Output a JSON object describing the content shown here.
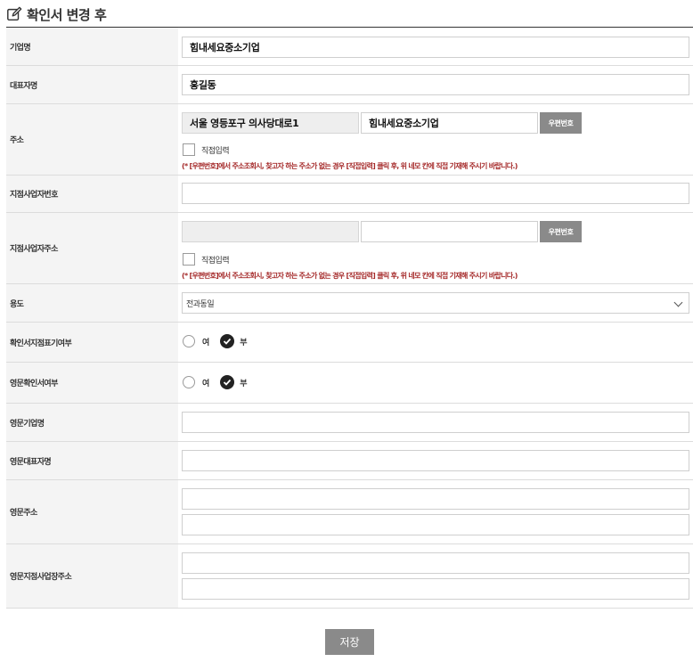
{
  "header": {
    "title": "확인서 변경 후",
    "icon": "edit-icon"
  },
  "fields": {
    "company_name": {
      "label": "기업명",
      "value": "힘내세요중소기업"
    },
    "ceo_name": {
      "label": "대표자명",
      "value": "홍길동"
    },
    "address": {
      "label": "주소",
      "street": "서울 영등포구 의사당대로1",
      "detail": "힘내세요중소기업",
      "zip_button": "우편번호",
      "manual_label": "직접입력",
      "notice": "(* [우편번호]에서 주소조회시, 찾고자 하는 주소가 없는 경우 [직접입력] 클릭 후, 위 네모 칸에 직접 기재해 주시기 바랍니다.)"
    },
    "branch_reg_no": {
      "label": "지점사업자번호",
      "value": ""
    },
    "branch_address": {
      "label": "지점사업자주소",
      "street": "",
      "detail": "",
      "zip_button": "우편번호",
      "manual_label": "직접입력",
      "notice": "(* [우편번호]에서 주소조회시, 찾고자 하는 주소가 없는 경우 [직접입력] 클릭 후, 위 네모 칸에 직접 기재해 주시기 바랍니다.)"
    },
    "purpose": {
      "label": "용도",
      "selected": "전과동일"
    },
    "branch_display": {
      "label": "확인서지점표기여부",
      "option_yes": "여",
      "option_no": "부",
      "selected": "부"
    },
    "english_cert": {
      "label": "영문확인서여부",
      "option_yes": "여",
      "option_no": "부",
      "selected": "부"
    },
    "english_company": {
      "label": "영문기업명",
      "value": ""
    },
    "english_ceo": {
      "label": "영문대표자명",
      "value": ""
    },
    "english_address": {
      "label": "영문주소",
      "line1": "",
      "line2": ""
    },
    "english_branch_address": {
      "label": "영문지점사업장주소",
      "line1": "",
      "line2": ""
    }
  },
  "actions": {
    "save": "저장"
  },
  "colors": {
    "button_gray": "#8a8a8a",
    "notice_red": "#a52a2a",
    "label_bg": "#f4f4f4"
  }
}
